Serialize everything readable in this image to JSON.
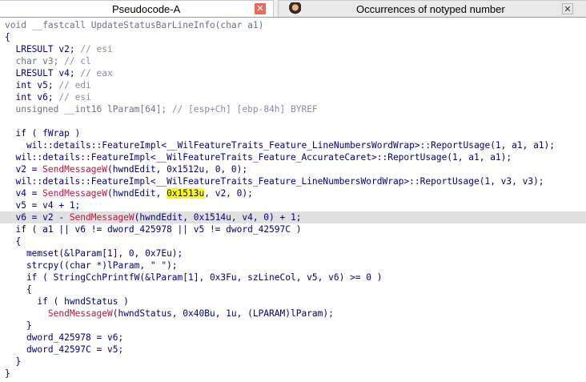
{
  "tabs": [
    {
      "label": "Pseudocode-A",
      "close_glyph": "✕"
    },
    {
      "label": "Occurrences of notyped number",
      "close_glyph": "✕",
      "icon": "user-avatar-icon"
    }
  ],
  "colors": {
    "keyword": "#00007f",
    "comment": "#8a8ab5",
    "function_call": "#c0143c",
    "highlight": "#ffff00",
    "current_line": "#e0e0e0"
  },
  "code": {
    "current_line_index": 16,
    "lines": [
      [
        [
          "void __fastcall UpdateStatusBarLineInfo(char a1)",
          "gray"
        ]
      ],
      [
        [
          "{",
          "var"
        ]
      ],
      [
        [
          "  LRESULT v2; ",
          "var"
        ],
        [
          "// esi",
          "cm"
        ]
      ],
      [
        [
          "  char v3; ",
          "gray"
        ],
        [
          "// cl",
          "cm"
        ]
      ],
      [
        [
          "  LRESULT v4; ",
          "var"
        ],
        [
          "// eax",
          "cm"
        ]
      ],
      [
        [
          "  int v5; ",
          "var"
        ],
        [
          "// edi",
          "cm"
        ]
      ],
      [
        [
          "  int v6; ",
          "var"
        ],
        [
          "// esi",
          "cm"
        ]
      ],
      [
        [
          "  unsigned __int16 lParam[64]; ",
          "gray"
        ],
        [
          "// [esp+Ch] [ebp-84h] BYREF",
          "cm"
        ]
      ],
      [
        [
          "",
          "var"
        ]
      ],
      [
        [
          "  if ( fWrap )",
          "var"
        ]
      ],
      [
        [
          "    wil::details::FeatureImpl<__WilFeatureTraits_Feature_LineNumbersWordWrap>::ReportUsage(1, a1, a1);",
          "var"
        ]
      ],
      [
        [
          "  wil::details::FeatureImpl<__WilFeatureTraits_Feature_AccurateCaret>::ReportUsage(1, a1, a1);",
          "var"
        ]
      ],
      [
        [
          "  v2 = ",
          "var"
        ],
        [
          "SendMessageW",
          "fn"
        ],
        [
          "(hwndEdit, 0x1512u, 0, 0);",
          "var"
        ]
      ],
      [
        [
          "  wil::details::FeatureImpl<__WilFeatureTraits_Feature_LineNumbersWordWrap>::ReportUsage(1, v3, v3);",
          "var"
        ]
      ],
      [
        [
          "  v4 = ",
          "var"
        ],
        [
          "SendMessageW",
          "fn"
        ],
        [
          "(hwndEdit, ",
          "var"
        ],
        [
          "0x1513u",
          "hl"
        ],
        [
          ", v2, 0);",
          "var"
        ]
      ],
      [
        [
          "  v5 = v4 + 1;",
          "var"
        ]
      ],
      [
        [
          "  v6 = v2 - ",
          "var"
        ],
        [
          "SendMessageW",
          "fn"
        ],
        [
          "(hwndEdit, 0x1514u, v4, 0) + 1;",
          "var"
        ]
      ],
      [
        [
          "  if ( a1 || v6 != dword_425978 || v5 != dword_42597C )",
          "var"
        ]
      ],
      [
        [
          "  {",
          "var"
        ]
      ],
      [
        [
          "    memset(&lParam[1], 0, 0x7Eu);",
          "var"
        ]
      ],
      [
        [
          "    strcpy((char *)lParam, \" \");",
          "var"
        ]
      ],
      [
        [
          "    if ( StringCchPrintfW(&lParam[1], 0x3Fu, szLineCol, v5, v6) >= 0 )",
          "var"
        ]
      ],
      [
        [
          "    {",
          "var"
        ]
      ],
      [
        [
          "      if ( hwndStatus )",
          "var"
        ]
      ],
      [
        [
          "        ",
          "var"
        ],
        [
          "SendMessageW",
          "fn"
        ],
        [
          "(hwndStatus, 0x40Bu, 1u, (LPARAM)lParam);",
          "var"
        ]
      ],
      [
        [
          "    }",
          "var"
        ]
      ],
      [
        [
          "    dword_425978 = v6;",
          "var"
        ]
      ],
      [
        [
          "    dword_42597C = v5;",
          "var"
        ]
      ],
      [
        [
          "  }",
          "var"
        ]
      ],
      [
        [
          "}",
          "var"
        ]
      ]
    ]
  }
}
